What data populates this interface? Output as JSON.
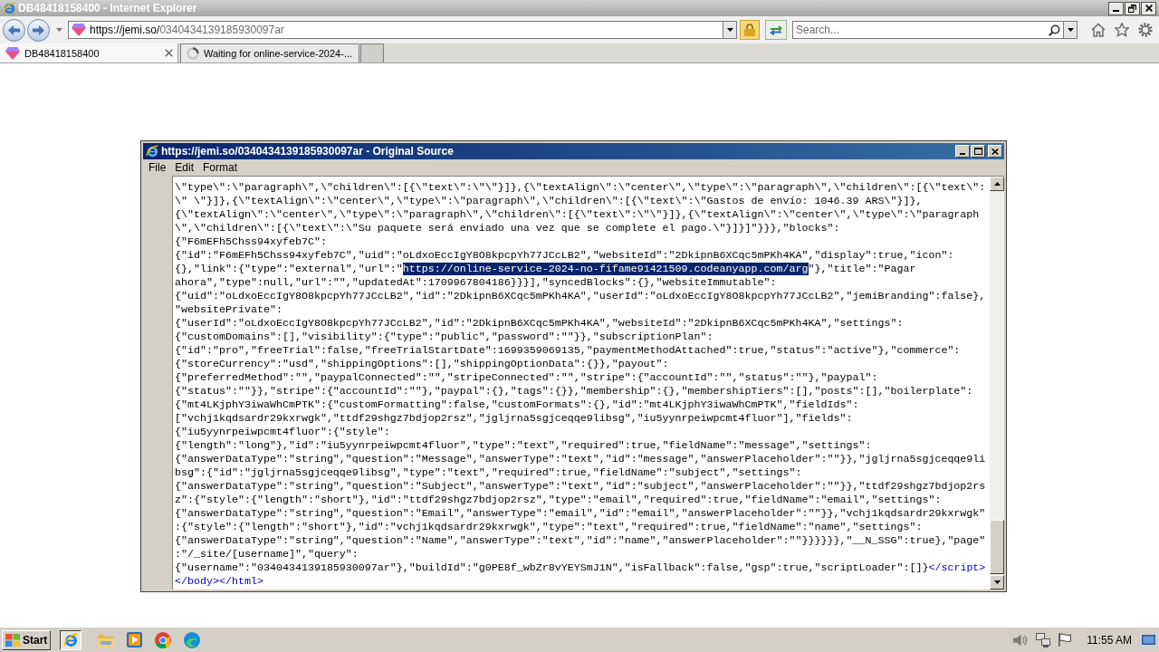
{
  "browser": {
    "title": "DB48418158400 - Internet Explorer",
    "address": {
      "host": "https://jemi.so/",
      "path": "0340434139185930097ar"
    },
    "search": {
      "placeholder": "Search..."
    },
    "tabs": [
      {
        "label": "DB48418158400",
        "selected": true,
        "loading": false
      },
      {
        "label": "Waiting for online-service-2024-...",
        "selected": false,
        "loading": true
      }
    ]
  },
  "source_window": {
    "title": "https://jemi.so/0340434139185930097ar - Original Source",
    "menu": [
      "File",
      "Edit",
      "Format"
    ],
    "lines": [
      [
        {
          "kind": "text",
          "text": "\\\"type\\\":\\\"paragraph\\\",\\\"children\\\":[{\\\"text\\\":\\\"\\\"}]},{\\\"textAlign\\\":\\\"center\\\",\\\"type\\\":\\\"paragraph\\\",\\\"children\\\":[{\\\"text\\\":"
        }
      ],
      [
        {
          "kind": "text",
          "text": "\\\" \\\"}]},{\\\"textAlign\\\":\\\"center\\\",\\\"type\\\":\\\"paragraph\\\",\\\"children\\\":[{\\\"text\\\":\\\"Gastos de envío: 1046.39 ARS\\\"}]},"
        }
      ],
      [
        {
          "kind": "text",
          "text": "{\\\"textAlign\\\":\\\"center\\\",\\\"type\\\":\\\"paragraph\\\",\\\"children\\\":[{\\\"text\\\":\\\"\\\"}]},{\\\"textAlign\\\":\\\"center\\\",\\\"type\\\":\\\"paragraph"
        }
      ],
      [
        {
          "kind": "text",
          "text": "\\\",\\\"children\\\":[{\\\"text\\\":\\\"Su paquete será enviado una vez que se complete el pago.\\\"}]}]\"}}},\"blocks\":"
        }
      ],
      [
        {
          "kind": "text",
          "text": "{\"F6mEFh5Chss94xyfeb7C\":"
        }
      ],
      [
        {
          "kind": "text",
          "text": "{\"id\":\"F6mEFh5Chss94xyfeb7C\",\"uid\":\"oLdxoEccIgY8O8kpcpYh77JCcLB2\",\"websiteId\":\"2DkipnB6XCqc5mPKh4KA\",\"display\":true,\"icon\":"
        }
      ],
      [
        {
          "kind": "text",
          "text": "{},\"link\":{\"type\":\"external\",\"url\":\""
        },
        {
          "kind": "selection",
          "text": "https://online-service-2024-no-fifame91421509.codeanyapp.com/arg"
        },
        {
          "kind": "text",
          "text": "\"},\"title\":\"Pagar"
        }
      ],
      [
        {
          "kind": "text",
          "text": "ahora\",\"type\":null,\"url\":\"\",\"updatedAt\":1709967804186}}}],\"syncedBlocks\":{},\"websiteImmutable\":"
        }
      ],
      [
        {
          "kind": "text",
          "text": "{\"uid\":\"oLdxoEccIgY8O8kpcpYh77JCcLB2\",\"id\":\"2DkipnB6XCqc5mPKh4KA\",\"userId\":\"oLdxoEccIgY8O8kpcpYh77JCcLB2\",\"jemiBranding\":false},"
        }
      ],
      [
        {
          "kind": "text",
          "text": "\"websitePrivate\":"
        }
      ],
      [
        {
          "kind": "text",
          "text": "{\"userId\":\"oLdxoEccIgY8O8kpcpYh77JCcLB2\",\"id\":\"2DkipnB6XCqc5mPKh4KA\",\"websiteId\":\"2DkipnB6XCqc5mPKh4KA\",\"settings\":"
        }
      ],
      [
        {
          "kind": "text",
          "text": "{\"customDomains\":[],\"visibility\":{\"type\":\"public\",\"password\":\"\"}},\"subscriptionPlan\":"
        }
      ],
      [
        {
          "kind": "text",
          "text": "{\"id\":\"pro\",\"freeTrial\":false,\"freeTrialStartDate\":1699359069135,\"paymentMethodAttached\":true,\"status\":\"active\"},\"commerce\":"
        }
      ],
      [
        {
          "kind": "text",
          "text": "{\"storeCurrency\":\"usd\",\"shippingOptions\":[],\"shippingOptionData\":{}},\"payout\":"
        }
      ],
      [
        {
          "kind": "text",
          "text": "{\"preferredMethod\":\"\",\"paypalConnected\":\"\",\"stripeConnected\":\"\",\"stripe\":{\"accountId\":\"\",\"status\":\"\"},\"paypal\":"
        }
      ],
      [
        {
          "kind": "text",
          "text": "{\"status\":\"\"}},\"stripe\":{\"accountId\":\"\"},\"paypal\":{},\"tags\":{}},\"membership\":{},\"membershipTiers\":[],\"posts\":[],\"boilerplate\":"
        }
      ],
      [
        {
          "kind": "text",
          "text": "{\"mt4LKjphY3iwaWhCmPTK\":{\"customFormatting\":false,\"customFormats\":{},\"id\":\"mt4LKjphY3iwaWhCmPTK\",\"fieldIds\":"
        }
      ],
      [
        {
          "kind": "text",
          "text": "[\"vchj1kqdsardr29kxrwgk\",\"ttdf29shgz7bdjop2rsz\",\"jgljrna5sgjceqqe9libsg\",\"iu5yynrpeiwpcmt4fluor\"],\"fields\":"
        }
      ],
      [
        {
          "kind": "text",
          "text": "{\"iu5yynrpeiwpcmt4fluor\":{\"style\":"
        }
      ],
      [
        {
          "kind": "text",
          "text": "{\"length\":\"long\"},\"id\":\"iu5yynrpeiwpcmt4fluor\",\"type\":\"text\",\"required\":true,\"fieldName\":\"message\",\"settings\":"
        }
      ],
      [
        {
          "kind": "text",
          "text": "{\"answerDataType\":\"string\",\"question\":\"Message\",\"answerType\":\"text\",\"id\":\"message\",\"answerPlaceholder\":\"\"}},\"jgljrna5sgjceqqe9li"
        }
      ],
      [
        {
          "kind": "text",
          "text": "bsg\":{\"id\":\"jgljrna5sgjceqqe9libsg\",\"type\":\"text\",\"required\":true,\"fieldName\":\"subject\",\"settings\":"
        }
      ],
      [
        {
          "kind": "text",
          "text": "{\"answerDataType\":\"string\",\"question\":\"Subject\",\"answerType\":\"text\",\"id\":\"subject\",\"answerPlaceholder\":\"\"}},\"ttdf29shgz7bdjop2rs"
        }
      ],
      [
        {
          "kind": "text",
          "text": "z\":{\"style\":{\"length\":\"short\"},\"id\":\"ttdf29shgz7bdjop2rsz\",\"type\":\"email\",\"required\":true,\"fieldName\":\"email\",\"settings\":"
        }
      ],
      [
        {
          "kind": "text",
          "text": "{\"answerDataType\":\"string\",\"question\":\"Email\",\"answerType\":\"email\",\"id\":\"email\",\"answerPlaceholder\":\"\"}},\"vchj1kqdsardr29kxrwgk\""
        }
      ],
      [
        {
          "kind": "text",
          "text": ":{\"style\":{\"length\":\"short\"},\"id\":\"vchj1kqdsardr29kxrwgk\",\"type\":\"text\",\"required\":true,\"fieldName\":\"name\",\"settings\":"
        }
      ],
      [
        {
          "kind": "text",
          "text": "{\"answerDataType\":\"string\",\"question\":\"Name\",\"answerType\":\"text\",\"id\":\"name\",\"answerPlaceholder\":\"\"}}}}}},\"__N_SSG\":true},\"page\""
        }
      ],
      [
        {
          "kind": "text",
          "text": ":\"/_site/[username]\",\"query\":"
        }
      ],
      [
        {
          "kind": "text",
          "text": "{\"username\":\"0340434139185930097ar\"},\"buildId\":\"g0PE8f_wbZr8vYEYSmJ1N\",\"isFallback\":false,\"gsp\":true,\"scriptLoader\":[]}"
        },
        {
          "kind": "tag",
          "text": "</script>"
        }
      ],
      [
        {
          "kind": "tag",
          "text": "</body></html>"
        }
      ]
    ]
  },
  "taskbar": {
    "start": "Start",
    "clock": "11:55 AM"
  }
}
